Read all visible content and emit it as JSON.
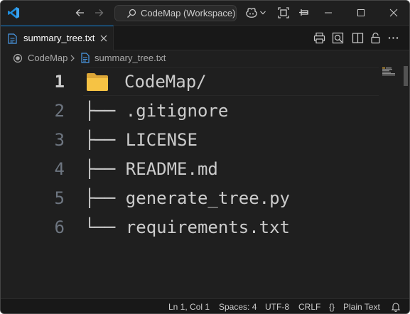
{
  "titlebar": {
    "command_center_label": "CodeMap (Workspace)",
    "icons": [
      "vscode-logo",
      "arrow-left-icon",
      "arrow-right-icon",
      "search-icon",
      "copilot-icon",
      "chevron-down-icon",
      "layout-icon",
      "pin-icon",
      "minimize-icon",
      "maximize-icon",
      "close-icon"
    ]
  },
  "tab": {
    "label": "summary_tree.txt",
    "accent_color": "#0078d4"
  },
  "tab_actions": [
    "print-icon",
    "open-preview-icon",
    "split-editor-icon",
    "lock-icon",
    "more-actions-icon"
  ],
  "breadcrumb": {
    "root": "CodeMap",
    "file": "summary_tree.txt"
  },
  "editor": {
    "lines": [
      {
        "num": "1",
        "text": "CodeMap/"
      },
      {
        "num": "2",
        "text": "├── .gitignore"
      },
      {
        "num": "3",
        "text": "├── LICENSE"
      },
      {
        "num": "4",
        "text": "├── README.md"
      },
      {
        "num": "5",
        "text": "├── generate_tree.py"
      },
      {
        "num": "6",
        "text": "└── requirements.txt"
      }
    ],
    "active_line": 1,
    "folder_color": "#f6c344"
  },
  "statusbar": {
    "position": "Ln 1, Col 1",
    "spaces": "Spaces: 4",
    "encoding": "UTF-8",
    "eol": "CRLF",
    "braces": "{}",
    "language": "Plain Text"
  }
}
